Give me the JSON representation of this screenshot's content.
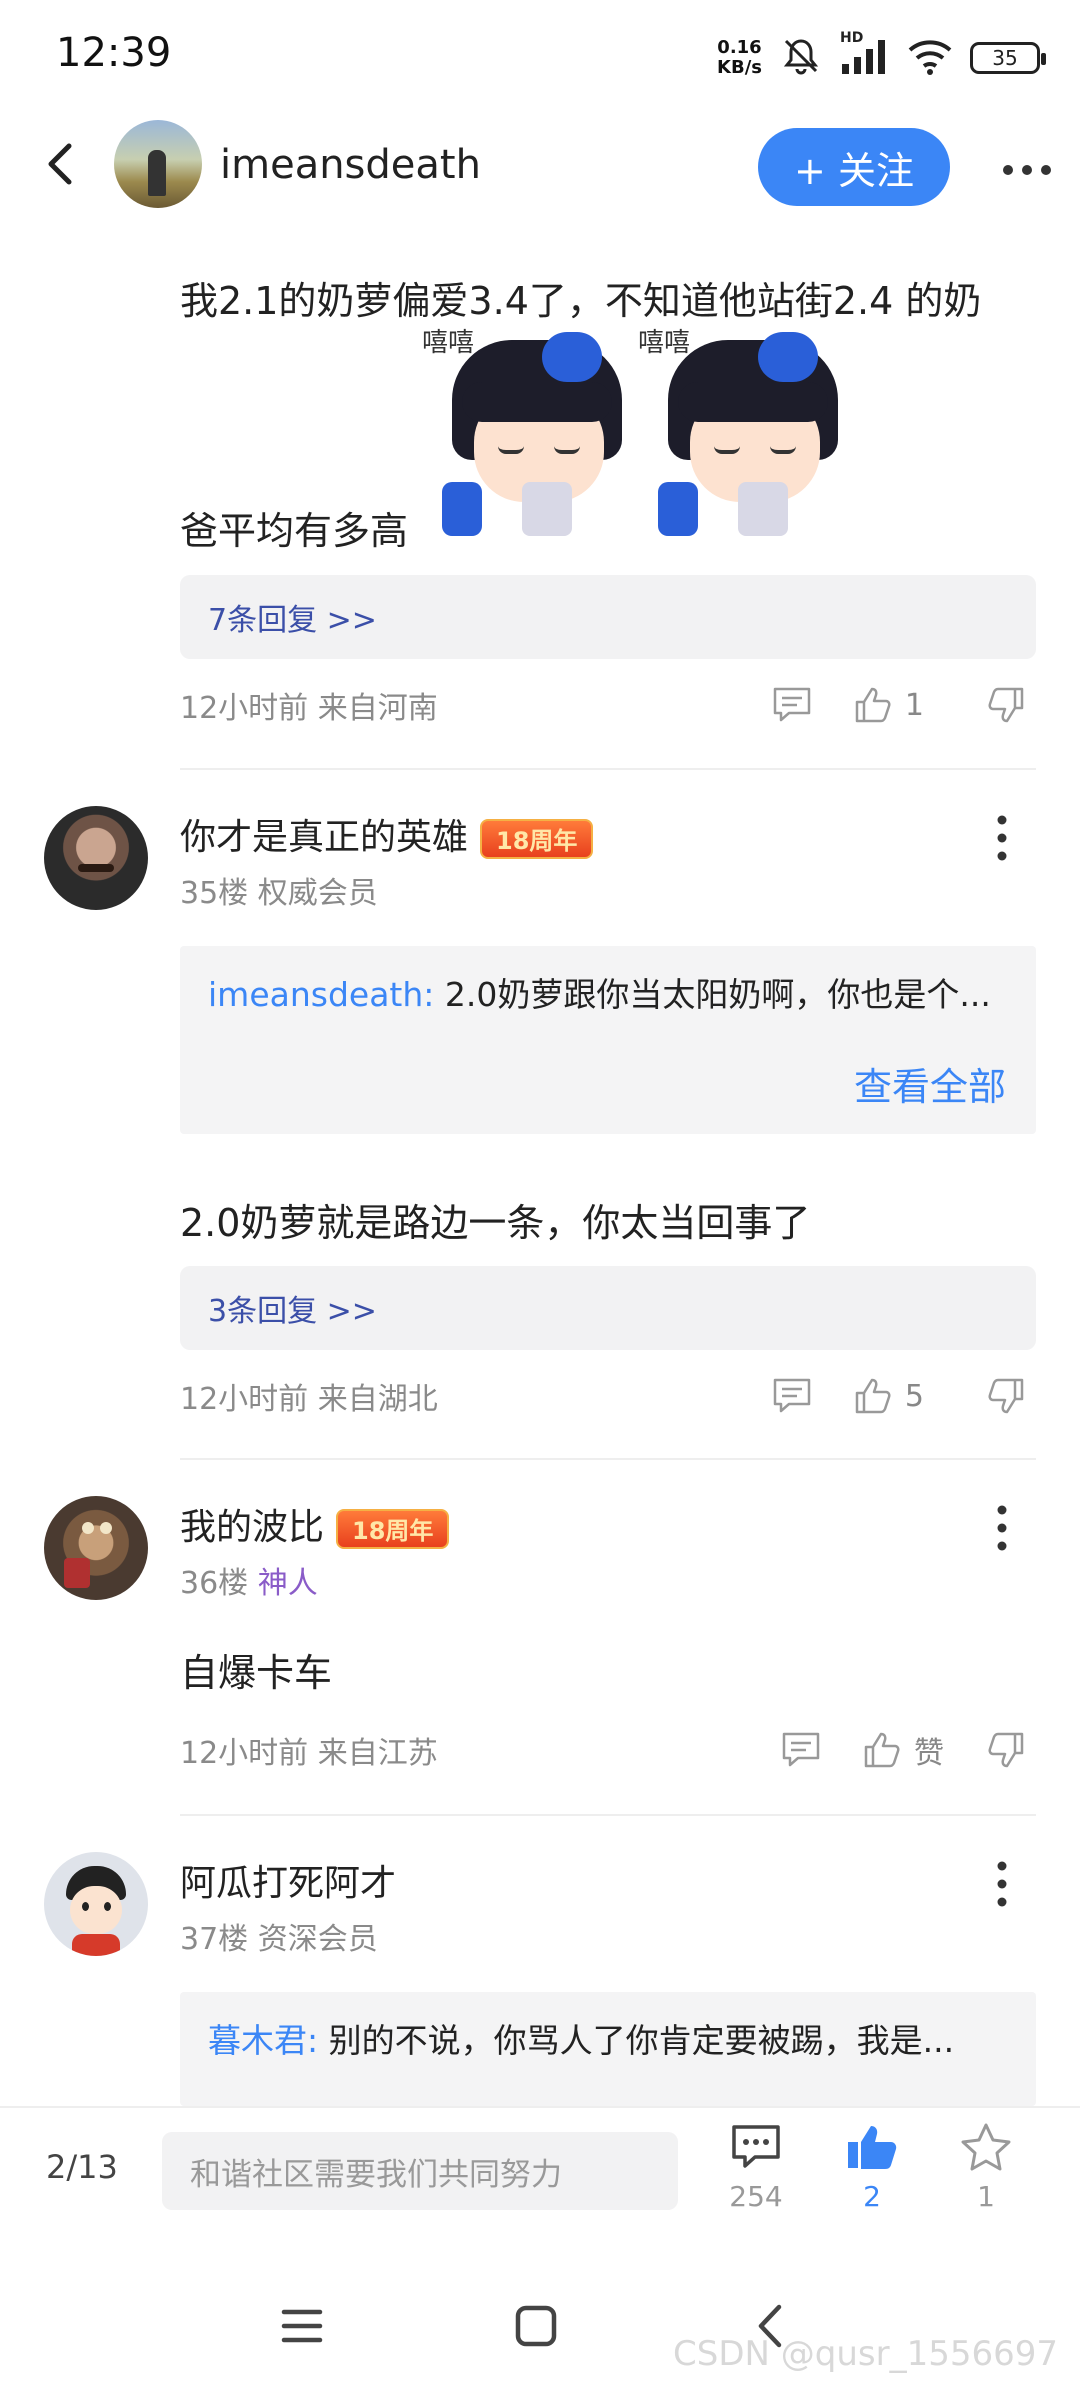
{
  "status_bar": {
    "time": "12:39",
    "net_speed_value": "0.16",
    "net_speed_unit": "KB/s",
    "network": "HD",
    "battery": "35"
  },
  "header": {
    "username": "imeansdeath",
    "follow_label": "+ 关注"
  },
  "post": {
    "text_line1": "我2.1的奶萝偏爱3.4了，不知道他站街2.4 的奶",
    "text_line2": "爸平均有多高",
    "sticker_text": "嘻嘻",
    "replies_link": "7条回复 >>",
    "meta": "12小时前 来自河南",
    "like_count": "1"
  },
  "comments": [
    {
      "nickname": "你才是真正的英雄",
      "badge": "18周年",
      "floor": "35楼",
      "rank": "权威会员",
      "quote_user": "imeansdeath:",
      "quote_text": "2.0奶萝跟你当太阳奶啊，你也是个...",
      "view_all": "查看全部",
      "text": "2.0奶萝就是路边一条，你太当回事了",
      "replies_link": "3条回复 >>",
      "meta": "12小时前 来自湖北",
      "like_count": "5"
    },
    {
      "nickname": "我的波比",
      "badge": "18周年",
      "floor": "36楼",
      "rank": "神人",
      "text": "自爆卡车",
      "meta": "12小时前 来自江苏",
      "like_label": "赞"
    },
    {
      "nickname": "阿瓜打死阿才",
      "floor": "37楼",
      "rank": "资深会员",
      "quote_user": "暮木君:",
      "quote_text": "别的不说，你骂人了你肯定要被踢，我是..."
    }
  ],
  "bottom_bar": {
    "page": "2/13",
    "input_placeholder": "和谐社区需要我们共同努力",
    "comment_count": "254",
    "like_count": "2",
    "star_count": "1"
  },
  "watermark": "CSDN @qusr_1556697",
  "colors": {
    "accent": "#3b86f6",
    "rank_special": "#8a5cc8",
    "link": "#3b4fa8",
    "meta": "#8a8a8a"
  }
}
